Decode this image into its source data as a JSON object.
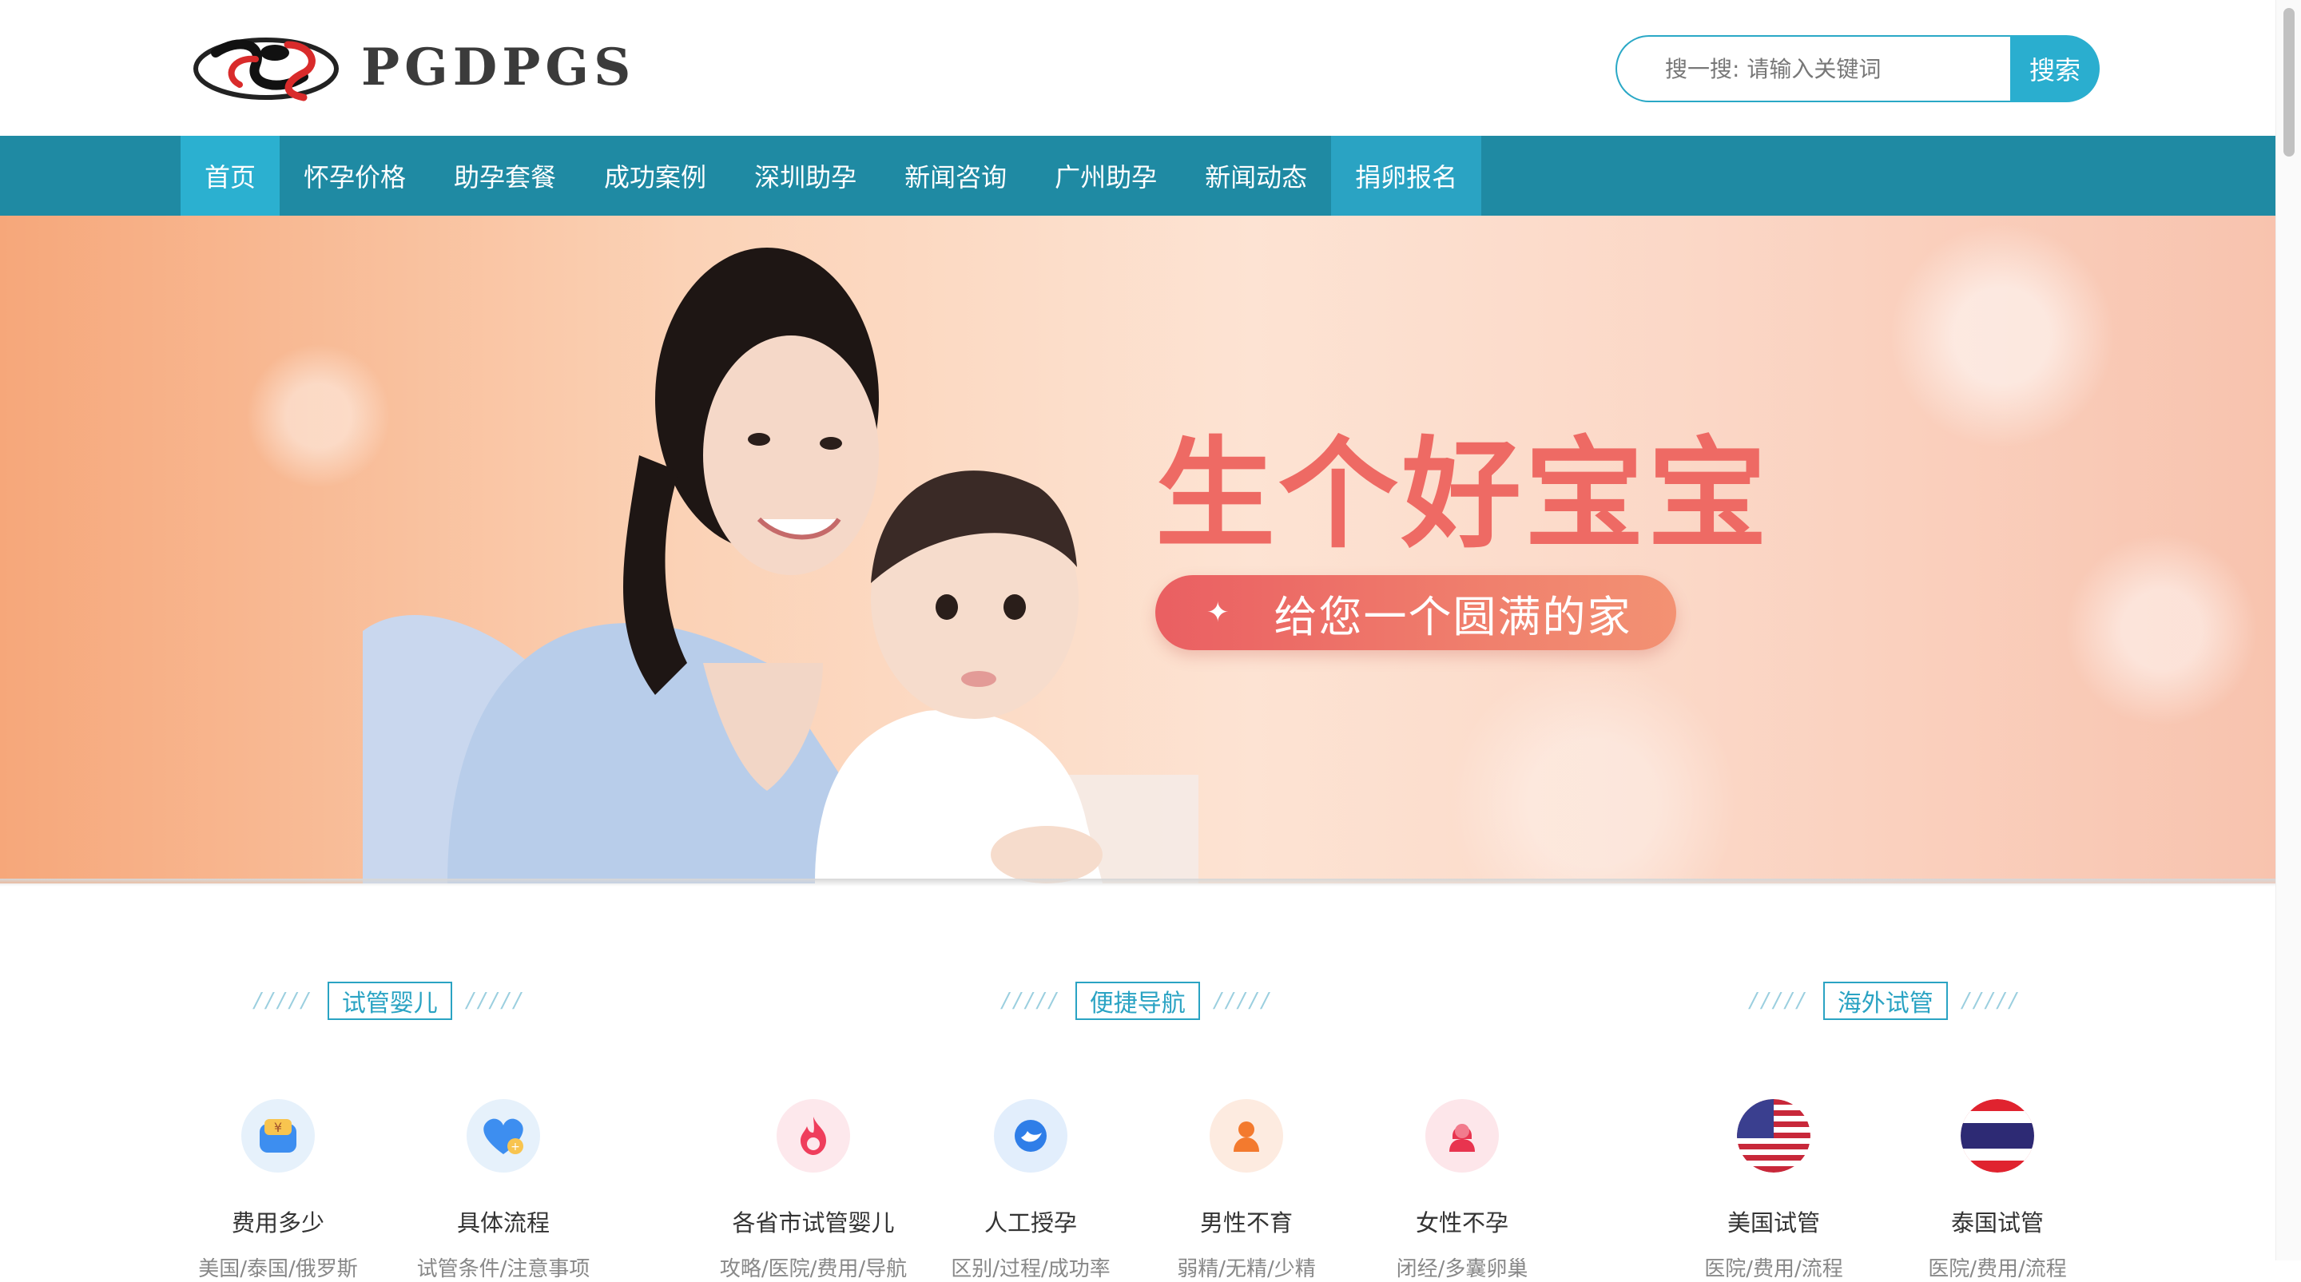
{
  "header": {
    "logo_text": "PGDPGS",
    "search_placeholder": "搜一搜: 请输入关键词",
    "search_button": "搜索"
  },
  "nav": {
    "items": [
      {
        "label": "首页"
      },
      {
        "label": "怀孕价格"
      },
      {
        "label": "助孕套餐"
      },
      {
        "label": "成功案例"
      },
      {
        "label": "深圳助孕"
      },
      {
        "label": "新闻咨询"
      },
      {
        "label": "广州助孕"
      },
      {
        "label": "新闻动态"
      },
      {
        "label": "捐卵报名"
      }
    ]
  },
  "banner": {
    "title": "生个好宝宝",
    "subtitle": "给您一个圆满的家",
    "colors": {
      "title": "#ee6a64",
      "pill": "#ea5f62"
    }
  },
  "sections": [
    {
      "title": "试管婴儿",
      "slashes_left": "/////",
      "slashes_right": "/////"
    },
    {
      "title": "便捷导航",
      "slashes_left": "/////",
      "slashes_right": "/////"
    },
    {
      "title": "海外试管",
      "slashes_left": "/////",
      "slashes_right": "/////"
    }
  ],
  "items": [
    {
      "label": "费用多少",
      "sub": "美国/泰国/俄罗斯",
      "icon": "money-bag-icon"
    },
    {
      "label": "具体流程",
      "sub": "试管条件/注意事项",
      "icon": "heart-plus-icon"
    },
    {
      "label": "各省市试管婴儿",
      "sub": "攻略/医院/费用/导航",
      "icon": "flame-icon"
    },
    {
      "label": "人工授孕",
      "sub": "区别/过程/成功率",
      "icon": "bird-icon"
    },
    {
      "label": "男性不育",
      "sub": "弱精/无精/少精",
      "icon": "male-user-icon"
    },
    {
      "label": "女性不孕",
      "sub": "闭经/多囊卵巢",
      "icon": "female-user-icon"
    },
    {
      "label": "美国试管",
      "sub": "医院/费用/流程",
      "icon": "usa-flag-icon"
    },
    {
      "label": "泰国试管",
      "sub": "医院/费用/流程",
      "icon": "thailand-flag-icon"
    }
  ],
  "colors": {
    "nav": "#1f8aa3",
    "accent": "#2aa3c3"
  }
}
